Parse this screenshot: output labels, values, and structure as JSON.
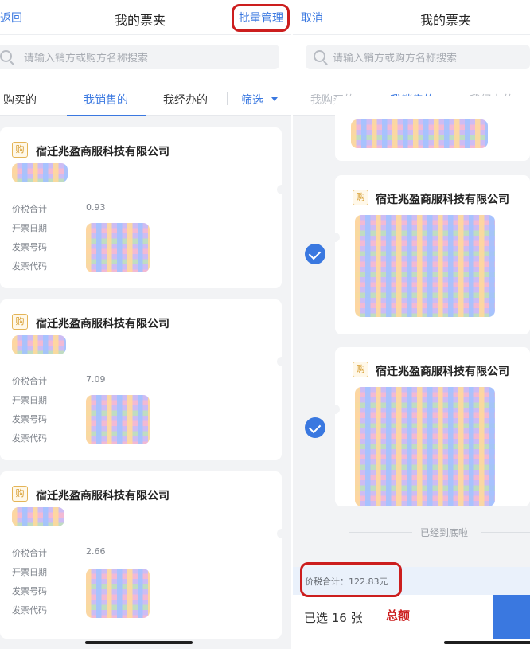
{
  "left": {
    "nav": {
      "back_label": "返回",
      "back_visible": "返回",
      "title": "我的票夹",
      "batch_label": "批量管理"
    },
    "search": {
      "placeholder": "请输入销方或购方名称搜索"
    },
    "tabs": [
      {
        "label": "我购买的",
        "visible": "购买的"
      },
      {
        "label": "我销售的",
        "visible": "我销售的"
      },
      {
        "label": "我经办的",
        "visible": "我经办的"
      }
    ],
    "filter_label": "筛选",
    "cards": [
      {
        "tag": "购",
        "company": "宿迁兆盈商服科技有限公司",
        "amount_label": "价税合计",
        "amount": "0.93",
        "date_label": "开票日期",
        "number_label": "发票号码",
        "code_label": "发票代码"
      },
      {
        "tag": "购",
        "company": "宿迁兆盈商服科技有限公司",
        "amount_label": "价税合计",
        "amount": "7.09",
        "date_label": "开票日期",
        "number_label": "发票号码",
        "code_label": "发票代码"
      },
      {
        "tag": "购",
        "company": "宿迁兆盈商服科技有限公司",
        "amount_label": "价税合计",
        "amount": "2.66",
        "date_label": "开票日期",
        "number_label": "发票号码",
        "code_label": "发票代码"
      }
    ]
  },
  "right": {
    "nav": {
      "cancel_label": "取消",
      "title": "我的票夹"
    },
    "search": {
      "placeholder": "请输入销方或购方名称搜索"
    },
    "tabs": [
      {
        "label": "我购买的"
      },
      {
        "label": "我销售的"
      },
      {
        "label": "我经办的"
      }
    ],
    "cards": [
      {
        "tag": "购",
        "company": "宿迁兆盈商服科技有限公司",
        "selected": true
      },
      {
        "tag": "购",
        "company": "宿迁兆盈商服科技有限公司",
        "selected": true
      }
    ],
    "end_text": "已经到底啦",
    "sum_text": "价税合计：122.83元",
    "selected_text": "已选 16 张",
    "annotation": "总额"
  },
  "colors": {
    "accent": "#3a78e0",
    "highlight": "#cc1e1e",
    "tag": "#d59a2a"
  },
  "icons": [
    "search-icon",
    "checkmark-icon",
    "caret-down-icon"
  ]
}
